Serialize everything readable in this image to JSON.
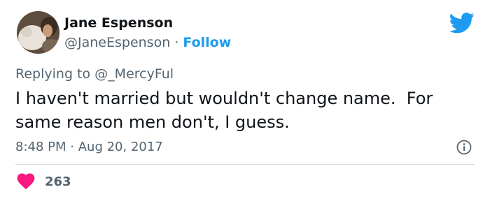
{
  "author": {
    "name": "Jane Espenson",
    "handle": "@JaneEspenson",
    "separator": "·",
    "follow_label": "Follow"
  },
  "reply": {
    "prefix": "Replying to",
    "mention": "@_MercyFul"
  },
  "tweet": {
    "text": "I haven't married but wouldn't change name.  For same reason men don't, I guess.",
    "time": "8:48 PM",
    "separator": "·",
    "date": "Aug 20, 2017"
  },
  "engagement": {
    "likes": "263"
  },
  "colors": {
    "accent": "#1d9bf0",
    "heart": "#f91880",
    "secondary_text": "#536471"
  },
  "icons": {
    "brand": "twitter-bird-icon",
    "info": "info-icon",
    "like": "heart-icon"
  }
}
